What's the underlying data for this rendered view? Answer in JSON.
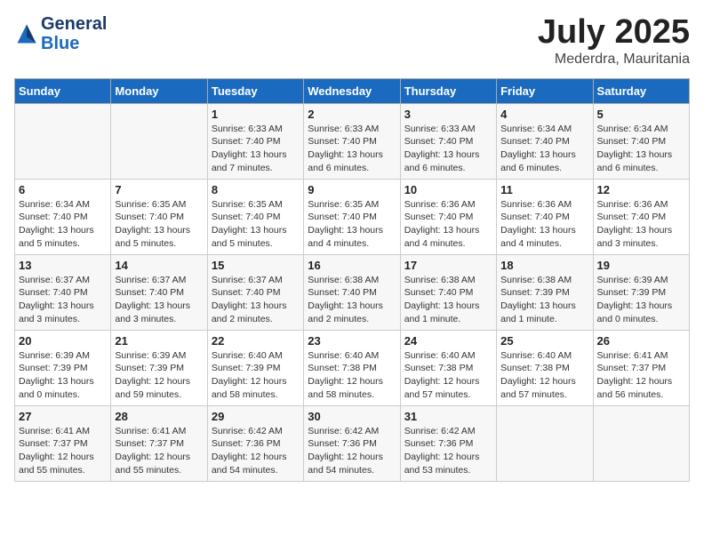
{
  "header": {
    "logo_general": "General",
    "logo_blue": "Blue",
    "month_title": "July 2025",
    "location": "Mederdra, Mauritania"
  },
  "days_of_week": [
    "Sunday",
    "Monday",
    "Tuesday",
    "Wednesday",
    "Thursday",
    "Friday",
    "Saturday"
  ],
  "weeks": [
    [
      {
        "day": "",
        "info": ""
      },
      {
        "day": "",
        "info": ""
      },
      {
        "day": "1",
        "info": "Sunrise: 6:33 AM\nSunset: 7:40 PM\nDaylight: 13 hours\nand 7 minutes."
      },
      {
        "day": "2",
        "info": "Sunrise: 6:33 AM\nSunset: 7:40 PM\nDaylight: 13 hours\nand 6 minutes."
      },
      {
        "day": "3",
        "info": "Sunrise: 6:33 AM\nSunset: 7:40 PM\nDaylight: 13 hours\nand 6 minutes."
      },
      {
        "day": "4",
        "info": "Sunrise: 6:34 AM\nSunset: 7:40 PM\nDaylight: 13 hours\nand 6 minutes."
      },
      {
        "day": "5",
        "info": "Sunrise: 6:34 AM\nSunset: 7:40 PM\nDaylight: 13 hours\nand 6 minutes."
      }
    ],
    [
      {
        "day": "6",
        "info": "Sunrise: 6:34 AM\nSunset: 7:40 PM\nDaylight: 13 hours\nand 5 minutes."
      },
      {
        "day": "7",
        "info": "Sunrise: 6:35 AM\nSunset: 7:40 PM\nDaylight: 13 hours\nand 5 minutes."
      },
      {
        "day": "8",
        "info": "Sunrise: 6:35 AM\nSunset: 7:40 PM\nDaylight: 13 hours\nand 5 minutes."
      },
      {
        "day": "9",
        "info": "Sunrise: 6:35 AM\nSunset: 7:40 PM\nDaylight: 13 hours\nand 4 minutes."
      },
      {
        "day": "10",
        "info": "Sunrise: 6:36 AM\nSunset: 7:40 PM\nDaylight: 13 hours\nand 4 minutes."
      },
      {
        "day": "11",
        "info": "Sunrise: 6:36 AM\nSunset: 7:40 PM\nDaylight: 13 hours\nand 4 minutes."
      },
      {
        "day": "12",
        "info": "Sunrise: 6:36 AM\nSunset: 7:40 PM\nDaylight: 13 hours\nand 3 minutes."
      }
    ],
    [
      {
        "day": "13",
        "info": "Sunrise: 6:37 AM\nSunset: 7:40 PM\nDaylight: 13 hours\nand 3 minutes."
      },
      {
        "day": "14",
        "info": "Sunrise: 6:37 AM\nSunset: 7:40 PM\nDaylight: 13 hours\nand 3 minutes."
      },
      {
        "day": "15",
        "info": "Sunrise: 6:37 AM\nSunset: 7:40 PM\nDaylight: 13 hours\nand 2 minutes."
      },
      {
        "day": "16",
        "info": "Sunrise: 6:38 AM\nSunset: 7:40 PM\nDaylight: 13 hours\nand 2 minutes."
      },
      {
        "day": "17",
        "info": "Sunrise: 6:38 AM\nSunset: 7:40 PM\nDaylight: 13 hours\nand 1 minute."
      },
      {
        "day": "18",
        "info": "Sunrise: 6:38 AM\nSunset: 7:39 PM\nDaylight: 13 hours\nand 1 minute."
      },
      {
        "day": "19",
        "info": "Sunrise: 6:39 AM\nSunset: 7:39 PM\nDaylight: 13 hours\nand 0 minutes."
      }
    ],
    [
      {
        "day": "20",
        "info": "Sunrise: 6:39 AM\nSunset: 7:39 PM\nDaylight: 13 hours\nand 0 minutes."
      },
      {
        "day": "21",
        "info": "Sunrise: 6:39 AM\nSunset: 7:39 PM\nDaylight: 12 hours\nand 59 minutes."
      },
      {
        "day": "22",
        "info": "Sunrise: 6:40 AM\nSunset: 7:39 PM\nDaylight: 12 hours\nand 58 minutes."
      },
      {
        "day": "23",
        "info": "Sunrise: 6:40 AM\nSunset: 7:38 PM\nDaylight: 12 hours\nand 58 minutes."
      },
      {
        "day": "24",
        "info": "Sunrise: 6:40 AM\nSunset: 7:38 PM\nDaylight: 12 hours\nand 57 minutes."
      },
      {
        "day": "25",
        "info": "Sunrise: 6:40 AM\nSunset: 7:38 PM\nDaylight: 12 hours\nand 57 minutes."
      },
      {
        "day": "26",
        "info": "Sunrise: 6:41 AM\nSunset: 7:37 PM\nDaylight: 12 hours\nand 56 minutes."
      }
    ],
    [
      {
        "day": "27",
        "info": "Sunrise: 6:41 AM\nSunset: 7:37 PM\nDaylight: 12 hours\nand 55 minutes."
      },
      {
        "day": "28",
        "info": "Sunrise: 6:41 AM\nSunset: 7:37 PM\nDaylight: 12 hours\nand 55 minutes."
      },
      {
        "day": "29",
        "info": "Sunrise: 6:42 AM\nSunset: 7:36 PM\nDaylight: 12 hours\nand 54 minutes."
      },
      {
        "day": "30",
        "info": "Sunrise: 6:42 AM\nSunset: 7:36 PM\nDaylight: 12 hours\nand 54 minutes."
      },
      {
        "day": "31",
        "info": "Sunrise: 6:42 AM\nSunset: 7:36 PM\nDaylight: 12 hours\nand 53 minutes."
      },
      {
        "day": "",
        "info": ""
      },
      {
        "day": "",
        "info": ""
      }
    ]
  ]
}
